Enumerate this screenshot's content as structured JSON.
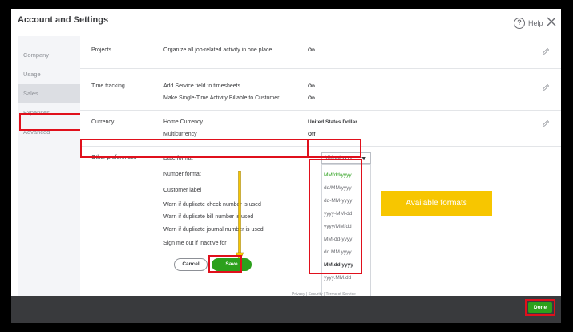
{
  "header": {
    "title": "Account and Settings",
    "help_label": "Help"
  },
  "sidebar": {
    "items": [
      {
        "label": "Company"
      },
      {
        "label": "Usage"
      },
      {
        "label": "Sales"
      },
      {
        "label": "Expenses"
      },
      {
        "label": "Advanced"
      }
    ]
  },
  "sections": {
    "projects": {
      "title": "Projects",
      "setting": "Organize all job-related activity in one place",
      "value": "On"
    },
    "time_tracking": {
      "title": "Time tracking",
      "rows": [
        {
          "setting": "Add Service field to timesheets",
          "value": "On"
        },
        {
          "setting": "Make Single-Time Activity Billable to Customer",
          "value": "On"
        }
      ]
    },
    "currency": {
      "title": "Currency",
      "rows": [
        {
          "setting": "Home Currency",
          "value": "United States Dollar"
        },
        {
          "setting": "Multicurrency",
          "value": "Off"
        }
      ]
    },
    "other_preferences": {
      "title": "Other preferences",
      "date_format_label": "Date format",
      "date_format_value": "MM.dd.yyyy",
      "rows": [
        {
          "setting": "Number format"
        },
        {
          "setting": "Customer label"
        },
        {
          "setting": "Warn if duplicate check number is used"
        },
        {
          "setting": "Warn if duplicate bill number is used"
        },
        {
          "setting": "Warn if duplicate journal number is used"
        },
        {
          "setting": "Sign me out if inactive for"
        }
      ]
    }
  },
  "date_format_options": [
    "MM/dd/yyyy",
    "dd/MM/yyyy",
    "dd-MM-yyyy",
    "yyyy-MM-dd",
    "yyyy/MM/dd",
    "MM-dd-yyyy",
    "dd.MM.yyyy",
    "MM.dd.yyyy",
    "yyyy.MM.dd"
  ],
  "callout": {
    "text": "Available formats"
  },
  "buttons": {
    "cancel": "Cancel",
    "save": "Save",
    "done": "Done"
  },
  "footer": {
    "links": "Privacy  |  Security  |  Terms of Service"
  },
  "colors": {
    "accent": "#2ca01c",
    "highlight": "#e0101c",
    "callout": "#f7c600"
  },
  "icons": {
    "help": "help-circle-icon",
    "close": "close-x-icon",
    "edit": "pencil-icon",
    "dropdown": "caret-down-icon"
  }
}
